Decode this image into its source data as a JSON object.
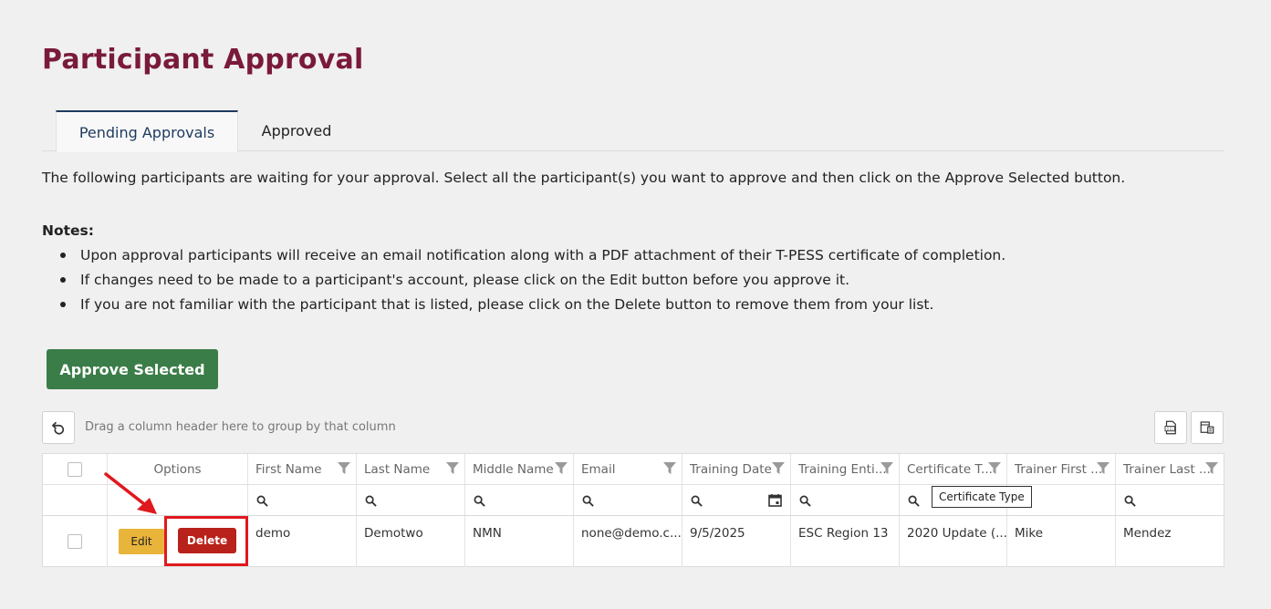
{
  "page": {
    "title": "Participant Approval"
  },
  "tabs": [
    {
      "label": "Pending Approvals"
    },
    {
      "label": "Approved"
    }
  ],
  "intro": "The following participants are waiting for your approval. Select all the participant(s) you want to approve and then click on the Approve Selected button.",
  "notes": {
    "title": "Notes:",
    "items": [
      "Upon approval participants will receive an email notification along with a PDF attachment of their T-PESS certificate of completion.",
      "If changes need to be made to a participant's account, please click on the Edit button before you approve it.",
      "If you are not familiar with the participant that is listed, please click on the Delete button to remove them from your list."
    ]
  },
  "actions": {
    "approve_label": "Approve Selected"
  },
  "grid": {
    "group_hint": "Drag a column header here to group by that column",
    "columns": [
      "Options",
      "First Name",
      "Last Name",
      "Middle Name",
      "Email",
      "Training Date",
      "Training Enti...",
      "Certificate T...",
      "Trainer First ...",
      "Trainer Last ..."
    ],
    "rows": [
      {
        "edit_label": "Edit",
        "delete_label": "Delete",
        "first_name": "demo",
        "last_name": "Demotwo",
        "middle_name": "NMN",
        "email": "none@demo.c...",
        "training_date": "9/5/2025",
        "training_entity": "ESC Region 13",
        "certificate_type": "2020 Update (...",
        "trainer_first": "Mike",
        "trainer_last": "Mendez"
      }
    ],
    "tooltip": "Certificate Type"
  },
  "colors": {
    "title": "#7a1a3a",
    "approve": "#3b7d48",
    "edit": "#e8b43a",
    "delete": "#b8221a",
    "highlight": "#e0191e"
  }
}
